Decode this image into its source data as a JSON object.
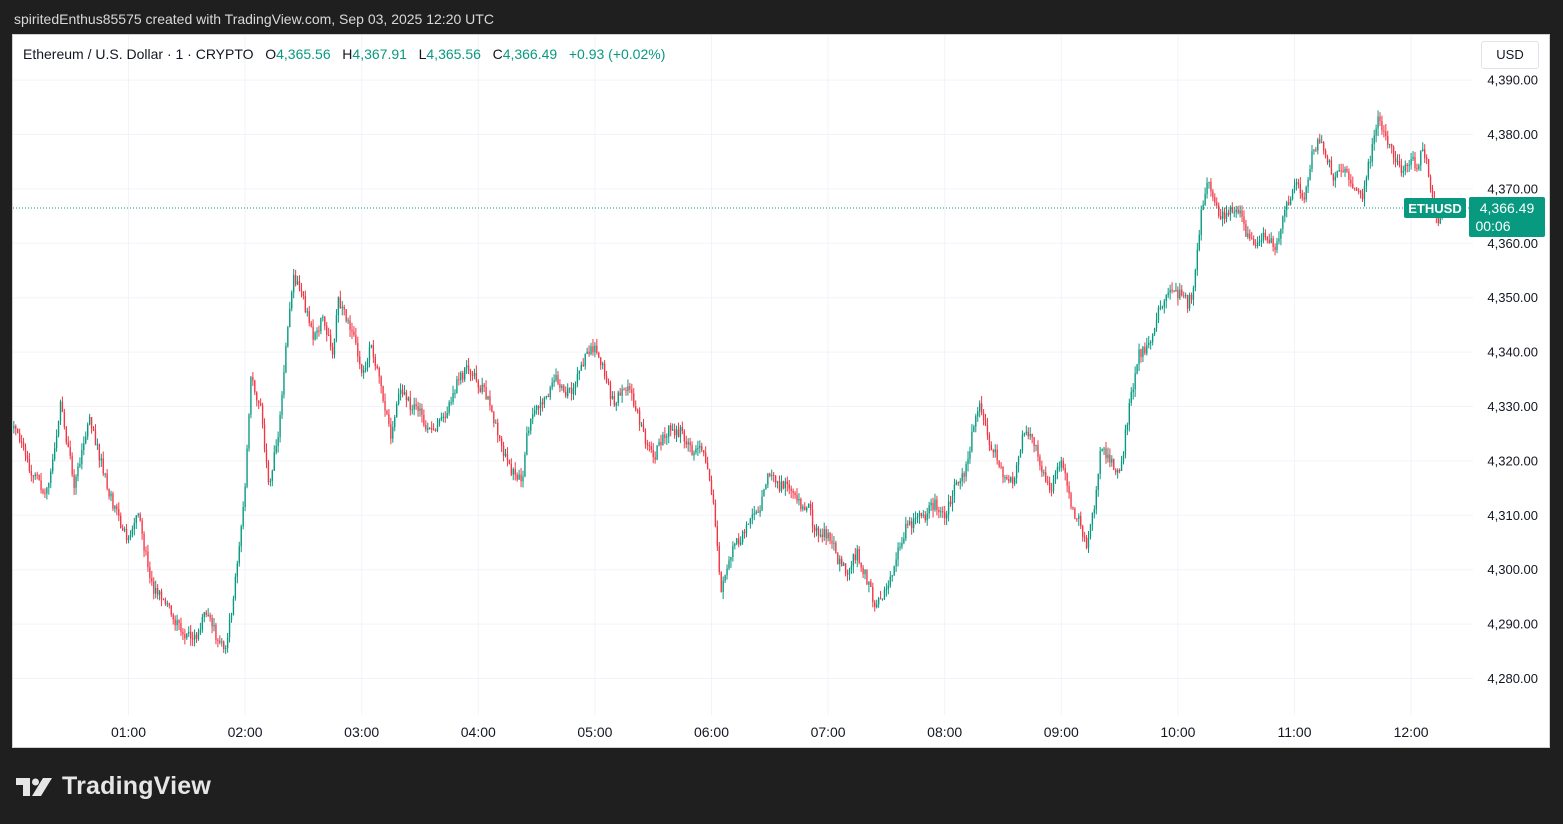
{
  "caption": "spiritedEnthus85575 created with TradingView.com, Sep 03, 2025 12:20 UTC",
  "legend": {
    "symbol": "Ethereum / U.S. Dollar · 1 · CRYPTO",
    "o_label": "O",
    "o_value": "4,365.56",
    "h_label": "H",
    "h_value": "4,367.91",
    "l_label": "L",
    "l_value": "4,365.56",
    "c_label": "C",
    "c_value": "4,366.49",
    "change": "+0.93 (+0.02%)"
  },
  "currency": "USD",
  "brand": "TradingView",
  "price_tag": {
    "ticker": "ETHUSD",
    "price": "4,366.49",
    "countdown": "00:06"
  },
  "colors": {
    "up": "#089981",
    "down": "#f23645",
    "grid": "#f0f3fa",
    "axis_text": "#131722",
    "price_line": "#089981"
  },
  "chart_data": {
    "type": "candlestick",
    "interval": "1 minute",
    "y_ticks": [
      4280,
      4290,
      4300,
      4310,
      4320,
      4330,
      4340,
      4350,
      4360,
      4370,
      4380,
      4390
    ],
    "y_tick_labels": [
      "4,280.00",
      "4,290.00",
      "4,300.00",
      "4,310.00",
      "4,320.00",
      "4,330.00",
      "4,340.00",
      "4,350.00",
      "4,360.00",
      "4,370.00",
      "4,380.00",
      "4,390.00"
    ],
    "x_tick_labels": [
      "01:00",
      "02:00",
      "03:00",
      "04:00",
      "05:00",
      "06:00",
      "07:00",
      "08:00",
      "09:00",
      "10:00",
      "11:00",
      "12:00"
    ],
    "x_range": [
      "00:01",
      "12:20"
    ],
    "ylim": [
      4272,
      4392
    ],
    "last_price": 4366.49,
    "price_path": [
      [
        "00:01",
        4326
      ],
      [
        "00:10",
        4318
      ],
      [
        "00:18",
        4314
      ],
      [
        "00:25",
        4330
      ],
      [
        "00:32",
        4316
      ],
      [
        "00:40",
        4328
      ],
      [
        "00:50",
        4314
      ],
      [
        "01:00",
        4305
      ],
      [
        "01:05",
        4310
      ],
      [
        "01:12",
        4297
      ],
      [
        "01:20",
        4293
      ],
      [
        "01:27",
        4289
      ],
      [
        "01:34",
        4287
      ],
      [
        "01:40",
        4292
      ],
      [
        "01:45",
        4288
      ],
      [
        "01:50",
        4286
      ],
      [
        "01:53",
        4292
      ],
      [
        "02:00",
        4315
      ],
      [
        "02:03",
        4335
      ],
      [
        "02:08",
        4330
      ],
      [
        "02:12",
        4315
      ],
      [
        "02:17",
        4325
      ],
      [
        "02:22",
        4345
      ],
      [
        "02:25",
        4354
      ],
      [
        "02:30",
        4350
      ],
      [
        "02:35",
        4342
      ],
      [
        "02:40",
        4346
      ],
      [
        "02:45",
        4340
      ],
      [
        "02:48",
        4349
      ],
      [
        "02:55",
        4344
      ],
      [
        "03:00",
        4336
      ],
      [
        "03:05",
        4341
      ],
      [
        "03:10",
        4333
      ],
      [
        "03:15",
        4325
      ],
      [
        "03:20",
        4334
      ],
      [
        "03:25",
        4330
      ],
      [
        "03:30",
        4329
      ],
      [
        "03:35",
        4325
      ],
      [
        "03:40",
        4327
      ],
      [
        "03:45",
        4330
      ],
      [
        "03:50",
        4335
      ],
      [
        "03:55",
        4337
      ],
      [
        "04:00",
        4334
      ],
      [
        "04:05",
        4332
      ],
      [
        "04:10",
        4325
      ],
      [
        "04:15",
        4320
      ],
      [
        "04:20",
        4316
      ],
      [
        "04:23",
        4318
      ],
      [
        "04:25",
        4325
      ],
      [
        "04:30",
        4330
      ],
      [
        "04:35",
        4332
      ],
      [
        "04:40",
        4336
      ],
      [
        "04:45",
        4332
      ],
      [
        "04:50",
        4334
      ],
      [
        "04:55",
        4339
      ],
      [
        "05:00",
        4341
      ],
      [
        "05:05",
        4336
      ],
      [
        "05:10",
        4330
      ],
      [
        "05:15",
        4334
      ],
      [
        "05:20",
        4331
      ],
      [
        "05:25",
        4325
      ],
      [
        "05:30",
        4320
      ],
      [
        "05:35",
        4325
      ],
      [
        "05:40",
        4326
      ],
      [
        "05:45",
        4325
      ],
      [
        "05:50",
        4322
      ],
      [
        "05:55",
        4322
      ],
      [
        "06:00",
        4315
      ],
      [
        "06:03",
        4305
      ],
      [
        "06:05",
        4296
      ],
      [
        "06:10",
        4303
      ],
      [
        "06:15",
        4306
      ],
      [
        "06:20",
        4309
      ],
      [
        "06:25",
        4312
      ],
      [
        "06:30",
        4318
      ],
      [
        "06:35",
        4315
      ],
      [
        "06:40",
        4316
      ],
      [
        "06:45",
        4312
      ],
      [
        "06:50",
        4311
      ],
      [
        "06:55",
        4306
      ],
      [
        "07:00",
        4307
      ],
      [
        "07:05",
        4302
      ],
      [
        "07:10",
        4300
      ],
      [
        "07:15",
        4303
      ],
      [
        "07:20",
        4298
      ],
      [
        "07:25",
        4293
      ],
      [
        "07:30",
        4297
      ],
      [
        "07:35",
        4302
      ],
      [
        "07:40",
        4308
      ],
      [
        "07:45",
        4309
      ],
      [
        "07:50",
        4310
      ],
      [
        "07:55",
        4312
      ],
      [
        "08:00",
        4310
      ],
      [
        "08:05",
        4315
      ],
      [
        "08:10",
        4318
      ],
      [
        "08:15",
        4326
      ],
      [
        "08:18",
        4330
      ],
      [
        "08:22",
        4325
      ],
      [
        "08:27",
        4320
      ],
      [
        "08:30",
        4318
      ],
      [
        "08:35",
        4316
      ],
      [
        "08:40",
        4324
      ],
      [
        "08:45",
        4325
      ],
      [
        "08:50",
        4318
      ],
      [
        "08:55",
        4315
      ],
      [
        "09:00",
        4320
      ],
      [
        "09:05",
        4312
      ],
      [
        "09:10",
        4308
      ],
      [
        "09:13",
        4305
      ],
      [
        "09:17",
        4312
      ],
      [
        "09:20",
        4322
      ],
      [
        "09:25",
        4320
      ],
      [
        "09:30",
        4318
      ],
      [
        "09:32",
        4322
      ],
      [
        "09:35",
        4330
      ],
      [
        "09:40",
        4340
      ],
      [
        "09:45",
        4341
      ],
      [
        "09:50",
        4348
      ],
      [
        "09:55",
        4351
      ],
      [
        "10:00",
        4351
      ],
      [
        "10:05",
        4349
      ],
      [
        "10:08",
        4351
      ],
      [
        "10:12",
        4366
      ],
      [
        "10:15",
        4372
      ],
      [
        "10:20",
        4366
      ],
      [
        "10:25",
        4365
      ],
      [
        "10:30",
        4367
      ],
      [
        "10:35",
        4362
      ],
      [
        "10:40",
        4360
      ],
      [
        "10:45",
        4362
      ],
      [
        "10:50",
        4359
      ],
      [
        "10:55",
        4366
      ],
      [
        "11:00",
        4371
      ],
      [
        "11:05",
        4369
      ],
      [
        "11:10",
        4378
      ],
      [
        "11:15",
        4378
      ],
      [
        "11:20",
        4372
      ],
      [
        "11:25",
        4374
      ],
      [
        "11:30",
        4370
      ],
      [
        "11:35",
        4368
      ],
      [
        "11:40",
        4378
      ],
      [
        "11:43",
        4383
      ],
      [
        "11:47",
        4380
      ],
      [
        "11:50",
        4377
      ],
      [
        "11:55",
        4373
      ],
      [
        "12:00",
        4376
      ],
      [
        "12:03",
        4374
      ],
      [
        "12:06",
        4378
      ],
      [
        "12:10",
        4371
      ],
      [
        "12:14",
        4363
      ],
      [
        "12:17",
        4366
      ],
      [
        "12:20",
        4366.49
      ]
    ]
  }
}
